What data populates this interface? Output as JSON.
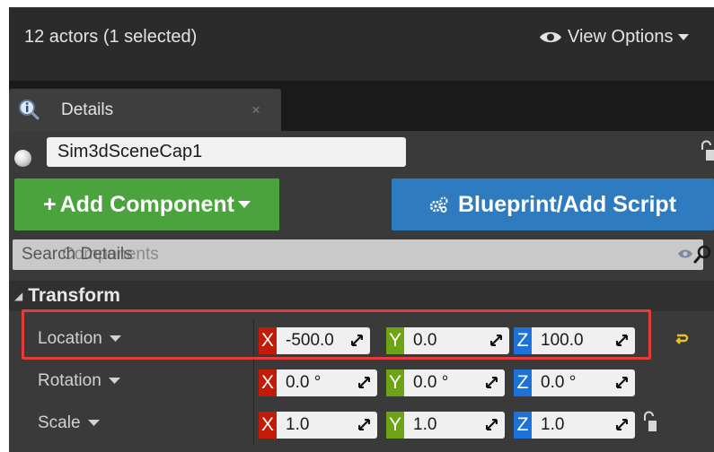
{
  "outliner": {
    "actor_count": "12 actors (1 selected)",
    "view_options_label": "View Options"
  },
  "details_tab": {
    "title": "Details",
    "close_glyph": "×"
  },
  "actor": {
    "name": "Sim3dSceneCap1"
  },
  "buttons": {
    "add_component": "Add Component",
    "add_component_prefix": "+",
    "blueprint": "Blueprint/Add Script"
  },
  "search": {
    "placeholder": "Search Details",
    "placeholder_under": "Components"
  },
  "transform": {
    "header": "Transform",
    "rows": [
      {
        "label": "Location",
        "x": "-500.0",
        "y": "0.0",
        "z": "100.0"
      },
      {
        "label": "Rotation",
        "x": "0.0 °",
        "y": "0.0 °",
        "z": "0.0 °"
      },
      {
        "label": "Scale",
        "x": "1.0",
        "y": "1.0",
        "z": "1.0"
      }
    ],
    "axis_labels": {
      "x": "X",
      "y": "Y",
      "z": "Z"
    }
  },
  "colors": {
    "add_component_bg": "#4aa33c",
    "blueprint_bg": "#2f7bbf",
    "axis_x": "#c21c09",
    "axis_y": "#6da415",
    "axis_z": "#1d72d8",
    "highlight": "#e63b3b",
    "reset_arrow": "#e8c321"
  },
  "icons": {
    "view_options": "eye-icon",
    "details": "info-magnifier-icon",
    "lock": "lock-icon",
    "blueprint": "gears-icon",
    "search": "search-icon",
    "reset": "reset-arrow-icon"
  }
}
